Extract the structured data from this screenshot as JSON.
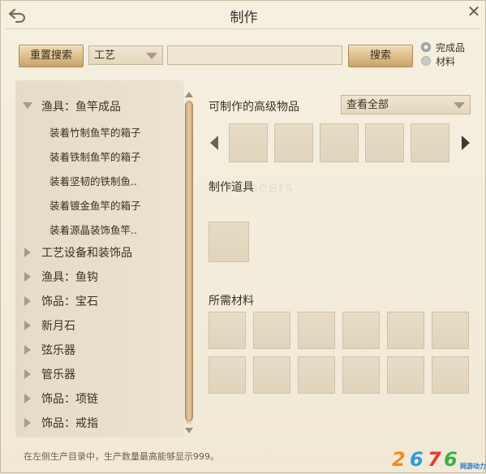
{
  "window": {
    "title": "制作",
    "back_icon": "back-arrow-icon",
    "close_glyph": "✕"
  },
  "toolbar": {
    "reset_label": "重置搜索",
    "category_value": "工艺",
    "search_value": "",
    "search_label": "搜索",
    "radio": [
      {
        "label": "完成品",
        "selected": true
      },
      {
        "label": "材料",
        "selected": false
      }
    ]
  },
  "tree": {
    "expanded": {
      "label": "渔具：鱼竿成品"
    },
    "children": [
      {
        "label": "装着竹制鱼竿的箱子"
      },
      {
        "label": "装着铁制鱼竿的箱子"
      },
      {
        "label": "装着坚韧的铁制鱼.."
      },
      {
        "label": "装着镀金鱼竿的箱子"
      },
      {
        "label": "装着源晶装饰鱼竿.."
      }
    ],
    "collapsed": [
      {
        "label": "工艺设备和装饰品"
      },
      {
        "label": "渔具：鱼钩"
      },
      {
        "label": "饰品：宝石"
      },
      {
        "label": "新月石"
      },
      {
        "label": "弦乐器"
      },
      {
        "label": "管乐器"
      },
      {
        "label": "饰品：项链"
      },
      {
        "label": "饰品：戒指"
      }
    ]
  },
  "right": {
    "advanced_label": "可制作的高级物品",
    "filter_value": "查看全部",
    "tools_label": "制作道具",
    "materials_label": "所需材料",
    "watermark": "Pioneers"
  },
  "footer": {
    "note": "在左侧生产目录中，生产数量最高能够显示999。"
  },
  "logo": {
    "digits": [
      "2",
      "6",
      "7",
      "6"
    ],
    "colors": [
      "#f28a1e",
      "#2c9be0",
      "#e8392f",
      "#3cb043"
    ],
    "caption": "网游动力"
  }
}
